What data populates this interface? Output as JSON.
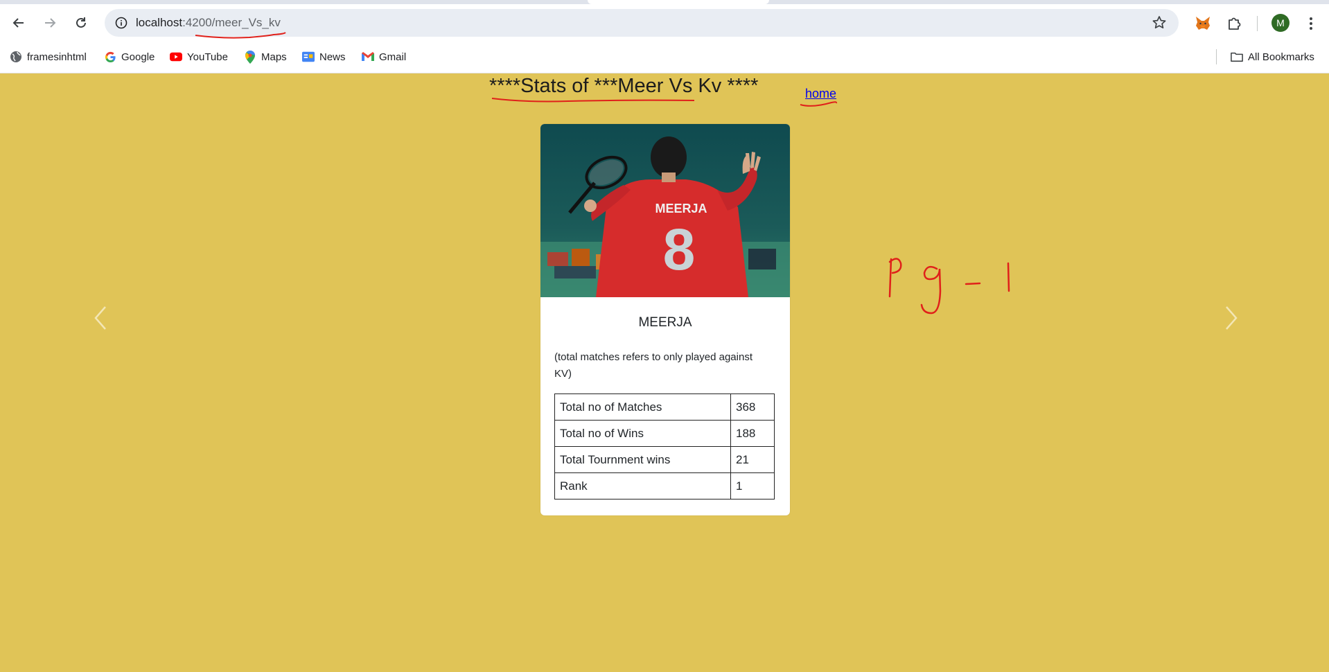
{
  "browser": {
    "url_host": "localhost",
    "url_port": ":4200",
    "url_path": "/meer_Vs_kv",
    "profile_initial": "M",
    "bookmarks": [
      {
        "label": "framesinhtml",
        "icon": "globe-icon"
      },
      {
        "label": "Google",
        "icon": "google-icon"
      },
      {
        "label": "YouTube",
        "icon": "youtube-icon"
      },
      {
        "label": "Maps",
        "icon": "maps-icon"
      },
      {
        "label": "News",
        "icon": "news-icon"
      },
      {
        "label": "Gmail",
        "icon": "gmail-icon"
      }
    ],
    "all_bookmarks_label": "All Bookmarks"
  },
  "page": {
    "title": "****Stats of ***Meer Vs Kv ****",
    "home_link": "home",
    "background_color": "#e0c457",
    "card": {
      "jersey_text": "MEERJA",
      "jersey_number": "8",
      "player_name": "MEERJA",
      "note": "(total matches refers to only played against KV)",
      "stats": [
        {
          "label": "Total no of Matches",
          "value": "368"
        },
        {
          "label": "Total no of Wins",
          "value": "188"
        },
        {
          "label": "Total Tournment wins",
          "value": "21"
        },
        {
          "label": "Rank",
          "value": "1"
        }
      ]
    },
    "handwritten_annotation": "Pg-1",
    "annotation_color": "#e0201a"
  }
}
